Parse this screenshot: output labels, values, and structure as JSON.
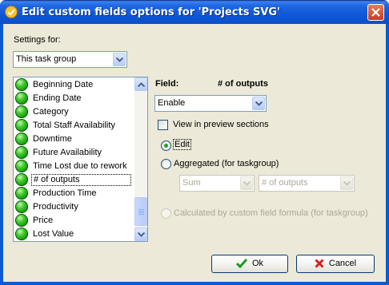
{
  "window": {
    "title": "Edit custom fields options for  'Projects SVG'"
  },
  "settings": {
    "label": "Settings for:",
    "value": "This task group"
  },
  "fields_list": [
    {
      "label": "Beginning Date",
      "selected": false
    },
    {
      "label": "Ending Date",
      "selected": false
    },
    {
      "label": "Category",
      "selected": false
    },
    {
      "label": "Total Staff Availability",
      "selected": false
    },
    {
      "label": "Downtime",
      "selected": false
    },
    {
      "label": "Future Availability",
      "selected": false
    },
    {
      "label": "Time Lost due to rework",
      "selected": false
    },
    {
      "label": "# of outputs",
      "selected": true
    },
    {
      "label": "Production Time",
      "selected": false
    },
    {
      "label": "Productivity",
      "selected": false
    },
    {
      "label": "Price",
      "selected": false
    },
    {
      "label": "Lost Value",
      "selected": false
    }
  ],
  "field": {
    "label": "Field:",
    "name": "# of outputs",
    "mode_value": "Enable",
    "view_in_preview_label": "View in preview sections",
    "view_in_preview_checked": false,
    "radio_edit_label": "Edit",
    "radio_aggregated_label": "Aggregated (for taskgroup)",
    "aggregate_function": "Sum",
    "aggregate_field": "# of outputs",
    "radio_calculated_label": "Calculated by custom field formula (for taskgroup)",
    "selected_option": "Edit"
  },
  "buttons": {
    "ok": "Ok",
    "cancel": "Cancel"
  },
  "colors": {
    "titlebar": "#0A5BD0",
    "dialog_bg": "#ECE9D8",
    "status_dot": "#21A121",
    "cancel_icon": "#D42020",
    "ok_icon": "#1E9A1E"
  }
}
